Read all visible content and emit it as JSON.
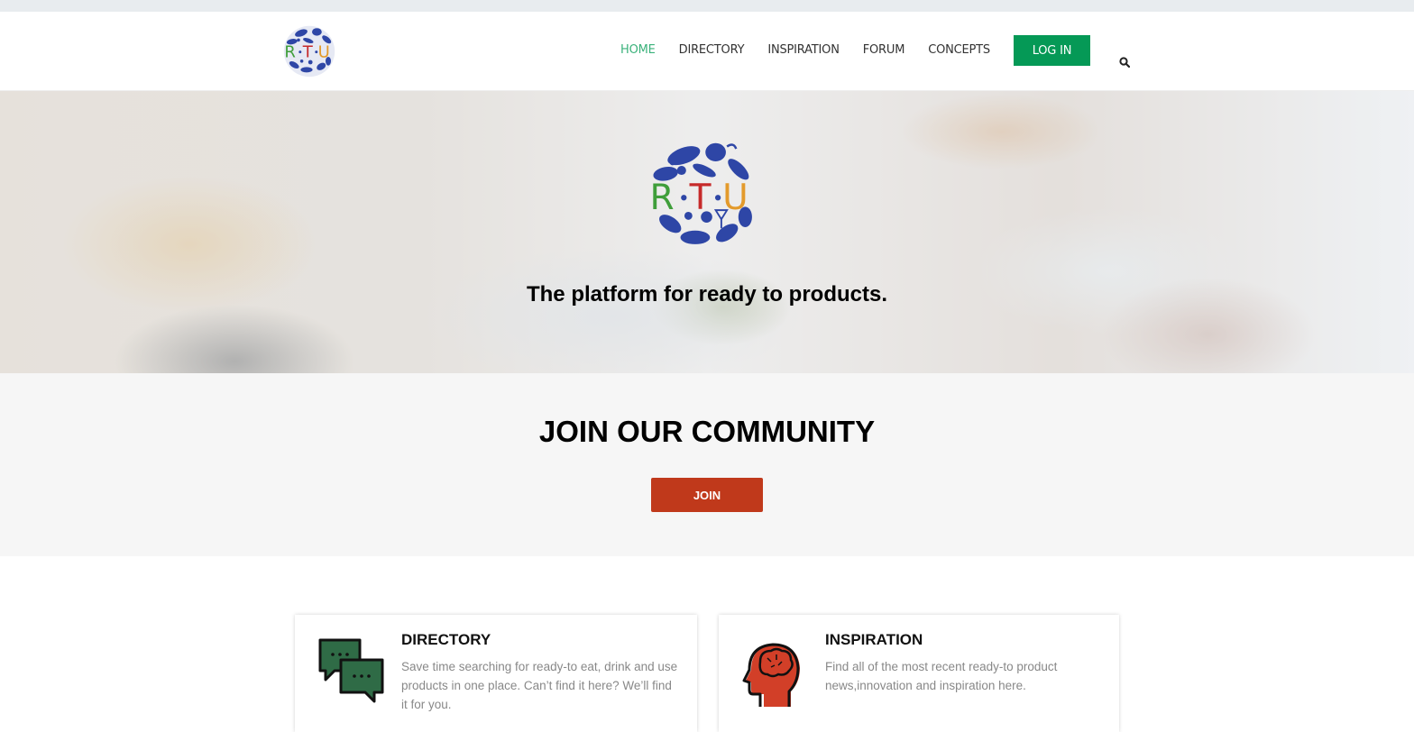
{
  "brand": {
    "logo_text": [
      "R",
      "T",
      "U"
    ],
    "logo_colors": {
      "r": "#3f9e3a",
      "t": "#c62a2a",
      "u": "#e39a2b",
      "circle": "#2e46a6"
    }
  },
  "nav": {
    "items": [
      {
        "label": "HOME",
        "active": true
      },
      {
        "label": "DIRECTORY",
        "active": false
      },
      {
        "label": "INSPIRATION",
        "active": false
      },
      {
        "label": "FORUM",
        "active": false
      },
      {
        "label": "CONCEPTS",
        "active": false
      }
    ],
    "login_label": "LOG IN",
    "search_icon": "search-icon"
  },
  "hero": {
    "tagline": "The platform for ready to  products."
  },
  "join": {
    "title": "JOIN OUR COMMUNITY",
    "button_label": "JOIN"
  },
  "features": [
    {
      "title": "DIRECTORY",
      "text": "Save time searching for ready-to eat, drink and use products in one place. Can’t find it here? We’ll find it for you.",
      "icon": "chat-bubbles-icon"
    },
    {
      "title": "INSPIRATION",
      "text": "Find all of the most recent ready-to product news,innovation and inspiration here.",
      "icon": "head-brain-icon"
    }
  ],
  "colors": {
    "accent_green": "#059956",
    "nav_active": "#3bb27b",
    "join_red": "#c0391b",
    "icon_green": "#2f6b46",
    "icon_red": "#d23f28"
  }
}
